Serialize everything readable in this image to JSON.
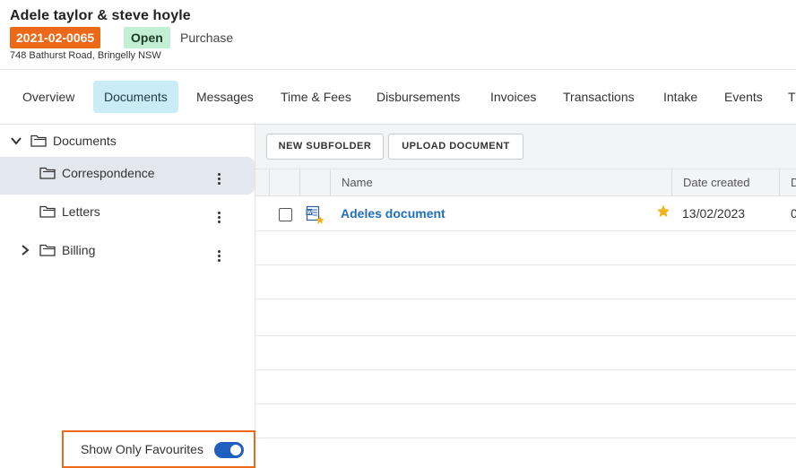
{
  "matter": {
    "title": "Adele taylor & steve hoyle",
    "number": "2021-02-0065",
    "status": "Open",
    "type": "Purchase",
    "address": "748 Bathurst Road, Bringelly NSW"
  },
  "tabs": [
    {
      "label": "Overview",
      "active": false
    },
    {
      "label": "Documents",
      "active": true
    },
    {
      "label": "Messages",
      "active": false
    },
    {
      "label": "Time & Fees",
      "active": false
    },
    {
      "label": "Disbursements",
      "active": false
    },
    {
      "label": "Invoices",
      "active": false
    },
    {
      "label": "Transactions",
      "active": false
    },
    {
      "label": "Intake",
      "active": false
    },
    {
      "label": "Events",
      "active": false
    },
    {
      "label": "T",
      "active": false
    }
  ],
  "sidebar": {
    "root": {
      "label": "Documents",
      "icon": "chevron-down-icon"
    },
    "folders": [
      {
        "label": "Correspondence",
        "selected": true
      },
      {
        "label": "Letters",
        "selected": false
      },
      {
        "label": "Billing",
        "selected": false,
        "expandable": true
      }
    ],
    "favourites_label": "Show Only Favourites",
    "favourites_on": true
  },
  "toolbar": {
    "new_subfolder": "NEW SUBFOLDER",
    "upload_document": "UPLOAD DOCUMENT"
  },
  "table": {
    "columns": [
      "Name",
      "Date created",
      "D"
    ],
    "rows": [
      {
        "name": "Adeles document",
        "date_created": "13/02/2023",
        "next_col": "0",
        "favourite": true,
        "icon": "word-document-icon"
      }
    ]
  },
  "colors": {
    "accent_orange": "#ec6a17",
    "status_green": "#c3f0d5",
    "active_tab": "#c9ecf7",
    "link_blue": "#1f6fc4",
    "toggle_blue": "#1f5fbf",
    "star_yellow": "#f2b21a"
  }
}
